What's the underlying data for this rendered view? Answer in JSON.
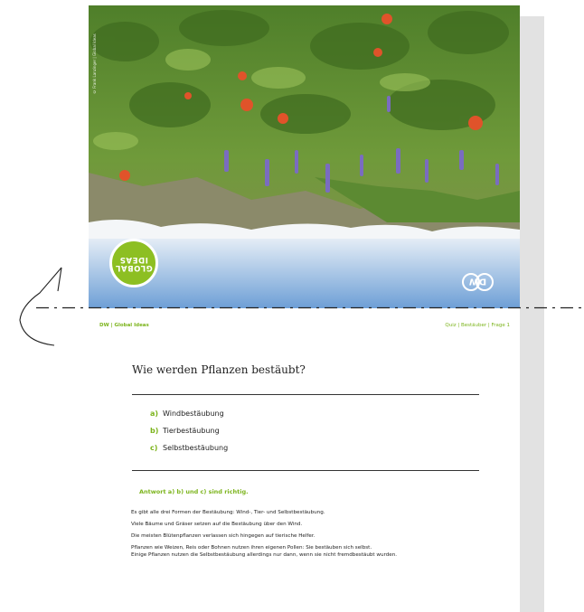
{
  "photo": {
    "credit": "© Frank Lanzinger | Global Ideas",
    "logo_text": "GLOBAL\nIDEAS",
    "brand_logo": "DW"
  },
  "header": {
    "left": "DW | Global Ideas",
    "right": "Quiz | Bestäuber | Frage 1"
  },
  "question": "Wie werden Pflanzen bestäubt?",
  "options": [
    {
      "letter": "a)",
      "text": "Windbestäubung"
    },
    {
      "letter": "b)",
      "text": "Tierbestäubung"
    },
    {
      "letter": "c)",
      "text": "Selbstbestäubung"
    }
  ],
  "answer": "Antwort a) b) und c) sind richtig.",
  "explanation": [
    "Es gibt alle drei Formen der Bestäubung: Wind-, Tier- und Selbstbestäubung.",
    "Viele Bäume und Gräser setzen auf die Bestäubung über den Wind.",
    "Die meisten Blütenpflanzen verlassen sich hingegen auf tierische Helfer.",
    "Pflanzen wie Weizen, Reis oder Bohnen nutzen ihren eigenen Pollen: Sie bestäuben sich selbst.",
    "Einige Pflanzen nutzen die Selbstbestäubung allerdings nur dann, wenn sie nicht fremdbestäubt wurden."
  ],
  "colors": {
    "accent": "#7cb41c",
    "logo_green": "#8dbf22",
    "text": "#222222"
  }
}
